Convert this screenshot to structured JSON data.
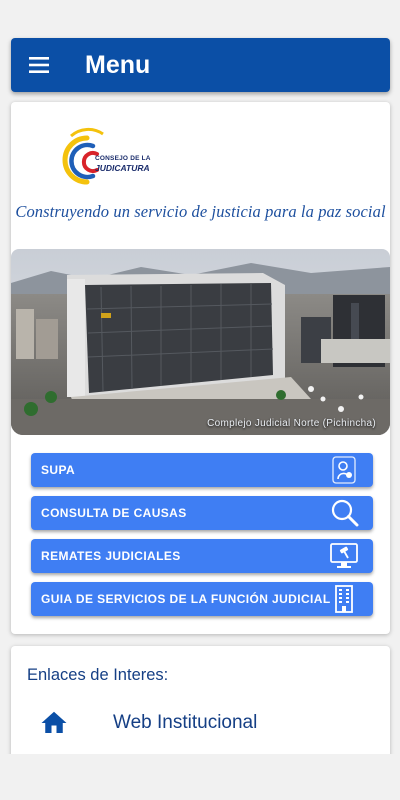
{
  "header": {
    "title": "Menu",
    "menu_icon": "hamburger-menu-icon",
    "background": "#0b4fa6"
  },
  "main_card": {
    "logo": {
      "line1": "CONSEJO DE LA",
      "line2": "JUDICATURA"
    },
    "slogan": "Construyendo un servicio de justicia para la paz social",
    "photo_caption": "Complejo Judicial Norte (Pichincha)",
    "buttons": [
      {
        "label": "SUPA",
        "icon": "supa-icon"
      },
      {
        "label": "CONSULTA DE CAUSAS",
        "icon": "magnifier-icon"
      },
      {
        "label": "REMATES JUDICIALES",
        "icon": "monitor-gavel-icon"
      },
      {
        "label": "GUIA DE SERVICIOS DE LA FUNCIÓN JUDICIAL",
        "icon": "building-icon"
      }
    ],
    "button_color": "#3f7ef3"
  },
  "links_card": {
    "title": "Enlaces de Interes:",
    "items": [
      {
        "label": "Web Institucional",
        "icon": "home-icon"
      }
    ]
  }
}
